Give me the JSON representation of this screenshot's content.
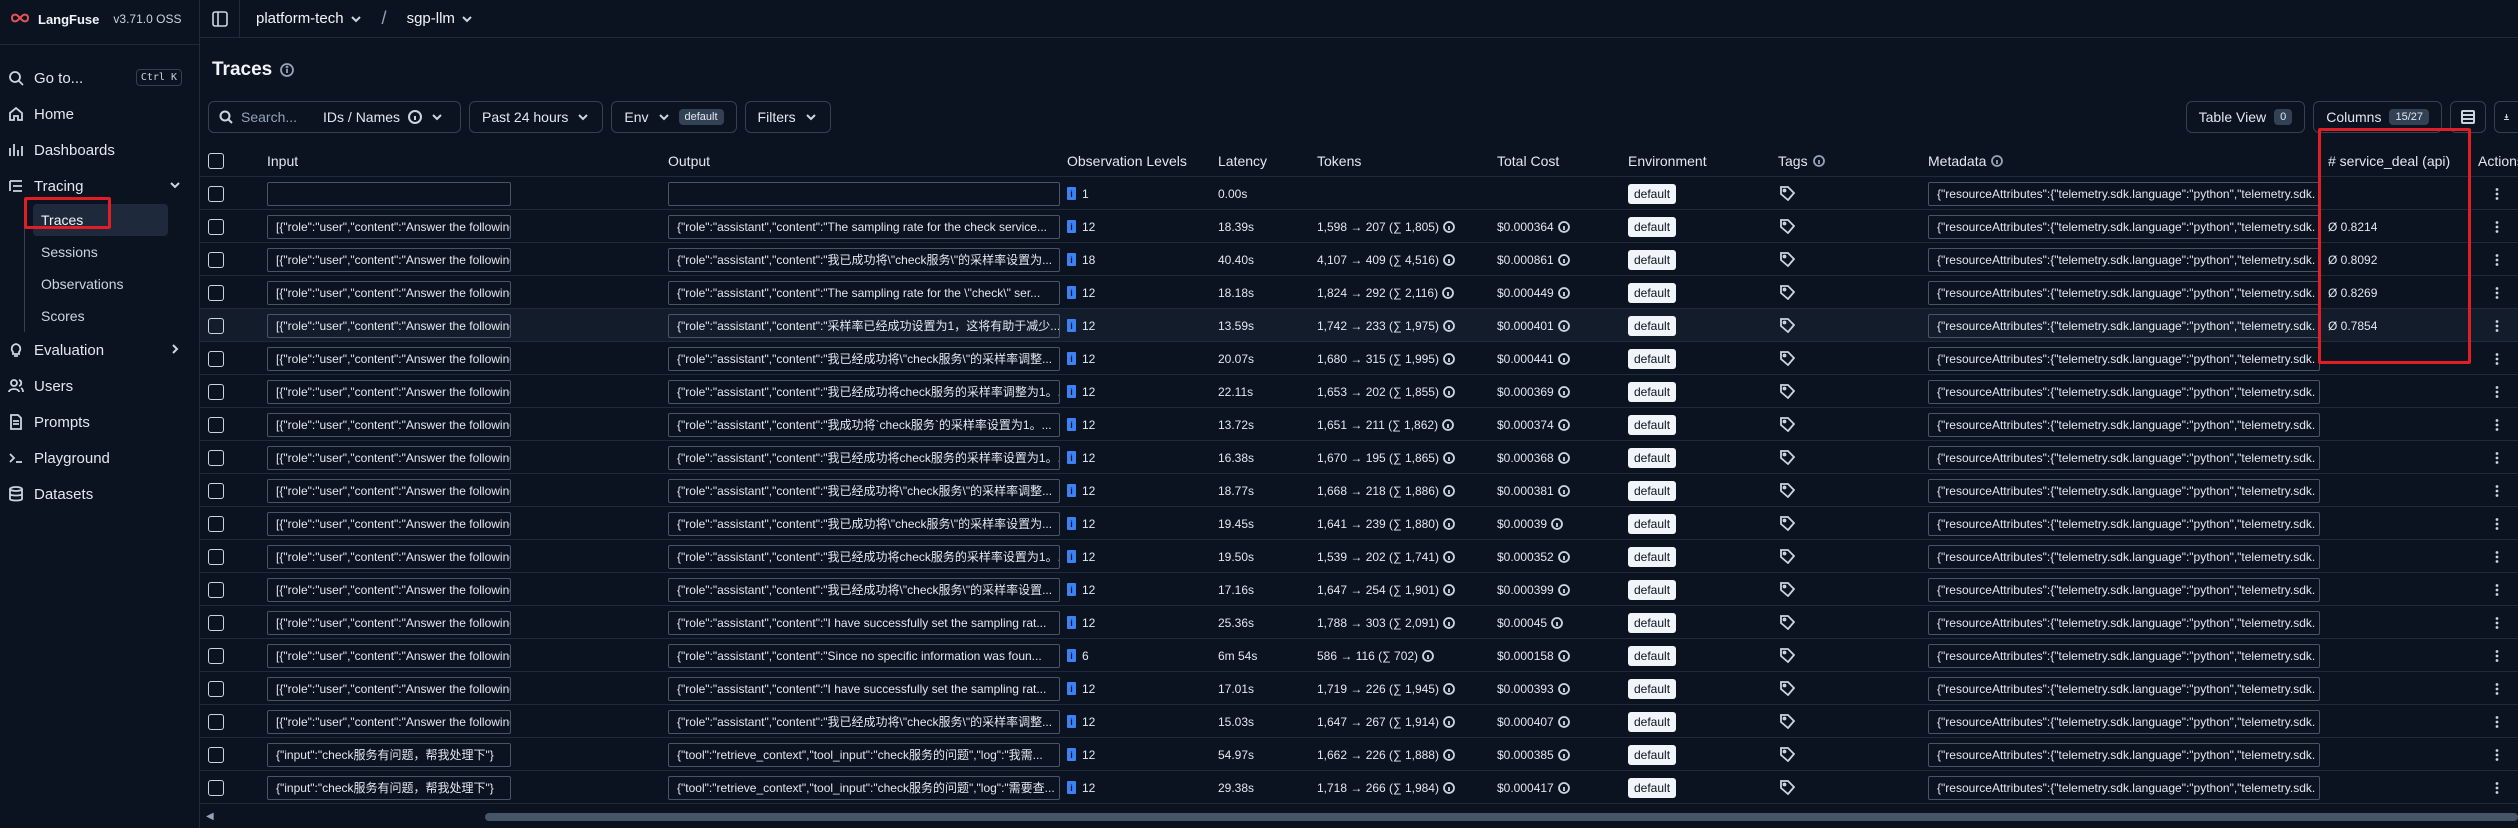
{
  "brand": {
    "name": "LangFuse",
    "version": "v3.71.0 OSS"
  },
  "sidebar": {
    "goto": {
      "label": "Go to...",
      "shortcut": "Ctrl K"
    },
    "home": "Home",
    "dashboards": "Dashboards",
    "tracing": {
      "label": "Tracing",
      "children": [
        "Traces",
        "Sessions",
        "Observations",
        "Scores"
      ]
    },
    "evaluation": "Evaluation",
    "users": "Users",
    "prompts": "Prompts",
    "playground": "Playground",
    "datasets": "Datasets"
  },
  "breadcrumb": {
    "org": "platform-tech",
    "sep": "/",
    "project": "sgp-llm"
  },
  "page": {
    "title": "Traces"
  },
  "toolbar": {
    "search_placeholder": "Search...",
    "search_mode": "IDs / Names",
    "time_range": "Past 24 hours",
    "env_label": "Env",
    "env_value": "default",
    "filters": "Filters",
    "table_view": "Table View",
    "table_view_count": "0",
    "columns": "Columns",
    "columns_count": "15/27"
  },
  "columns": {
    "input": "Input",
    "output": "Output",
    "observation_levels": "Observation Levels",
    "latency": "Latency",
    "tokens": "Tokens",
    "total_cost": "Total Cost",
    "environment": "Environment",
    "tags": "Tags",
    "metadata": "Metadata",
    "service_deal": "# service_deal (api)",
    "actions": "Actions"
  },
  "rows": [
    {
      "input": "",
      "output": "",
      "obs": "1",
      "latency": "0.00s",
      "tokens": "",
      "cost": "",
      "env": "default",
      "metadata": "{\"resourceAttributes\":{\"telemetry.sdk.language\":\"python\",\"telemetry.sdk.",
      "score": ""
    },
    {
      "input": "[{\"role\":\"user\",\"content\":\"Answer the following questions as best yo...",
      "output": "{\"role\":\"assistant\",\"content\":\"The sampling rate for the check service...",
      "obs": "12",
      "latency": "18.39s",
      "tokens": "1,598 → 207 (∑ 1,805)",
      "cost": "$0.000364",
      "env": "default",
      "metadata": "{\"resourceAttributes\":{\"telemetry.sdk.language\":\"python\",\"telemetry.sdk.",
      "score": "Ø 0.8214"
    },
    {
      "input": "[{\"role\":\"user\",\"content\":\"Answer the following questions as best yo...",
      "output": "{\"role\":\"assistant\",\"content\":\"我已成功将\\\"check服务\\\"的采样率设置为...",
      "obs": "18",
      "latency": "40.40s",
      "tokens": "4,107 → 409 (∑ 4,516)",
      "cost": "$0.000861",
      "env": "default",
      "metadata": "{\"resourceAttributes\":{\"telemetry.sdk.language\":\"python\",\"telemetry.sdk.",
      "score": "Ø 0.8092"
    },
    {
      "input": "[{\"role\":\"user\",\"content\":\"Answer the following questions as best yo...",
      "output": "{\"role\":\"assistant\",\"content\":\"The sampling rate for the \\\"check\\\" ser...",
      "obs": "12",
      "latency": "18.18s",
      "tokens": "1,824 → 292 (∑ 2,116)",
      "cost": "$0.000449",
      "env": "default",
      "metadata": "{\"resourceAttributes\":{\"telemetry.sdk.language\":\"python\",\"telemetry.sdk.",
      "score": "Ø 0.8269"
    },
    {
      "input": "[{\"role\":\"user\",\"content\":\"Answer the following questions as best yo...",
      "output": "{\"role\":\"assistant\",\"content\":\"采样率已经成功设置为1，这将有助于减少...",
      "obs": "12",
      "latency": "13.59s",
      "tokens": "1,742 → 233 (∑ 1,975)",
      "cost": "$0.000401",
      "env": "default",
      "metadata": "{\"resourceAttributes\":{\"telemetry.sdk.language\":\"python\",\"telemetry.sdk.",
      "score": "Ø 0.7854",
      "hl": true
    },
    {
      "input": "[{\"role\":\"user\",\"content\":\"Answer the following questions as best yo...",
      "output": "{\"role\":\"assistant\",\"content\":\"我已经成功将\\\"check服务\\\"的采样率调整...",
      "obs": "12",
      "latency": "20.07s",
      "tokens": "1,680 → 315 (∑ 1,995)",
      "cost": "$0.000441",
      "env": "default",
      "metadata": "{\"resourceAttributes\":{\"telemetry.sdk.language\":\"python\",\"telemetry.sdk.",
      "score": ""
    },
    {
      "input": "[{\"role\":\"user\",\"content\":\"Answer the following questions as best yo...",
      "output": "{\"role\":\"assistant\",\"content\":\"我已经成功将check服务的采样率调整为1。...",
      "obs": "12",
      "latency": "22.11s",
      "tokens": "1,653 → 202 (∑ 1,855)",
      "cost": "$0.000369",
      "env": "default",
      "metadata": "{\"resourceAttributes\":{\"telemetry.sdk.language\":\"python\",\"telemetry.sdk.",
      "score": ""
    },
    {
      "input": "[{\"role\":\"user\",\"content\":\"Answer the following questions as best yo...",
      "output": "{\"role\":\"assistant\",\"content\":\"我成功将`check服务`的采样率设置为1。...",
      "obs": "12",
      "latency": "13.72s",
      "tokens": "1,651 → 211 (∑ 1,862)",
      "cost": "$0.000374",
      "env": "default",
      "metadata": "{\"resourceAttributes\":{\"telemetry.sdk.language\":\"python\",\"telemetry.sdk.",
      "score": ""
    },
    {
      "input": "[{\"role\":\"user\",\"content\":\"Answer the following questions as best yo...",
      "output": "{\"role\":\"assistant\",\"content\":\"我已经成功将check服务的采样率设置为1。...",
      "obs": "12",
      "latency": "16.38s",
      "tokens": "1,670 → 195 (∑ 1,865)",
      "cost": "$0.000368",
      "env": "default",
      "metadata": "{\"resourceAttributes\":{\"telemetry.sdk.language\":\"python\",\"telemetry.sdk.",
      "score": ""
    },
    {
      "input": "[{\"role\":\"user\",\"content\":\"Answer the following questions as best yo...",
      "output": "{\"role\":\"assistant\",\"content\":\"我已经成功将\\\"check服务\\\"的采样率调整...",
      "obs": "12",
      "latency": "18.77s",
      "tokens": "1,668 → 218 (∑ 1,886)",
      "cost": "$0.000381",
      "env": "default",
      "metadata": "{\"resourceAttributes\":{\"telemetry.sdk.language\":\"python\",\"telemetry.sdk.",
      "score": ""
    },
    {
      "input": "[{\"role\":\"user\",\"content\":\"Answer the following questions as best yo...",
      "output": "{\"role\":\"assistant\",\"content\":\"我已成功将\\\"check服务\\\"的采样率设置为...",
      "obs": "12",
      "latency": "19.45s",
      "tokens": "1,641 → 239 (∑ 1,880)",
      "cost": "$0.00039",
      "env": "default",
      "metadata": "{\"resourceAttributes\":{\"telemetry.sdk.language\":\"python\",\"telemetry.sdk.",
      "score": ""
    },
    {
      "input": "[{\"role\":\"user\",\"content\":\"Answer the following questions as best yo...",
      "output": "{\"role\":\"assistant\",\"content\":\"我已经成功将check服务的采样率设置为1。...",
      "obs": "12",
      "latency": "19.50s",
      "tokens": "1,539 → 202 (∑ 1,741)",
      "cost": "$0.000352",
      "env": "default",
      "metadata": "{\"resourceAttributes\":{\"telemetry.sdk.language\":\"python\",\"telemetry.sdk.",
      "score": ""
    },
    {
      "input": "[{\"role\":\"user\",\"content\":\"Answer the following questions as best yo...",
      "output": "{\"role\":\"assistant\",\"content\":\"我已经成功将\\\"check服务\\\"的采样率设置...",
      "obs": "12",
      "latency": "17.16s",
      "tokens": "1,647 → 254 (∑ 1,901)",
      "cost": "$0.000399",
      "env": "default",
      "metadata": "{\"resourceAttributes\":{\"telemetry.sdk.language\":\"python\",\"telemetry.sdk.",
      "score": ""
    },
    {
      "input": "[{\"role\":\"user\",\"content\":\"Answer the following questions as best yo...",
      "output": "{\"role\":\"assistant\",\"content\":\"I have successfully set the sampling rat...",
      "obs": "12",
      "latency": "25.36s",
      "tokens": "1,788 → 303 (∑ 2,091)",
      "cost": "$0.00045",
      "env": "default",
      "metadata": "{\"resourceAttributes\":{\"telemetry.sdk.language\":\"python\",\"telemetry.sdk.",
      "score": ""
    },
    {
      "input": "[{\"role\":\"user\",\"content\":\"Answer the following questions as best yo...",
      "output": "{\"role\":\"assistant\",\"content\":\"Since no specific information was foun...",
      "obs": "6",
      "latency": "6m 54s",
      "tokens": "586 → 116 (∑ 702)",
      "cost": "$0.000158",
      "env": "default",
      "metadata": "{\"resourceAttributes\":{\"telemetry.sdk.language\":\"python\",\"telemetry.sdk.",
      "score": ""
    },
    {
      "input": "[{\"role\":\"user\",\"content\":\"Answer the following questions as best yo...",
      "output": "{\"role\":\"assistant\",\"content\":\"I have successfully set the sampling rat...",
      "obs": "12",
      "latency": "17.01s",
      "tokens": "1,719 → 226 (∑ 1,945)",
      "cost": "$0.000393",
      "env": "default",
      "metadata": "{\"resourceAttributes\":{\"telemetry.sdk.language\":\"python\",\"telemetry.sdk.",
      "score": ""
    },
    {
      "input": "[{\"role\":\"user\",\"content\":\"Answer the following questions as best yo...",
      "output": "{\"role\":\"assistant\",\"content\":\"我已经成功将\\\"check服务\\\"的采样率调整...",
      "obs": "12",
      "latency": "15.03s",
      "tokens": "1,647 → 267 (∑ 1,914)",
      "cost": "$0.000407",
      "env": "default",
      "metadata": "{\"resourceAttributes\":{\"telemetry.sdk.language\":\"python\",\"telemetry.sdk.",
      "score": ""
    },
    {
      "input": "{\"input\":\"check服务有问题，帮我处理下\"}",
      "output": "{\"tool\":\"retrieve_context\",\"tool_input\":\"check服务的问题\",\"log\":\"我需...",
      "obs": "12",
      "latency": "54.97s",
      "tokens": "1,662 → 226 (∑ 1,888)",
      "cost": "$0.000385",
      "env": "default",
      "metadata": "{\"resourceAttributes\":{\"telemetry.sdk.language\":\"python\",\"telemetry.sdk.",
      "score": ""
    },
    {
      "input": "{\"input\":\"check服务有问题，帮我处理下\"}",
      "output": "{\"tool\":\"retrieve_context\",\"tool_input\":\"check服务的问题\",\"log\":\"需要查...",
      "obs": "12",
      "latency": "29.38s",
      "tokens": "1,718 → 266 (∑ 1,984)",
      "cost": "$0.000417",
      "env": "default",
      "metadata": "{\"resourceAttributes\":{\"telemetry.sdk.language\":\"python\",\"telemetry.sdk.",
      "score": ""
    }
  ]
}
